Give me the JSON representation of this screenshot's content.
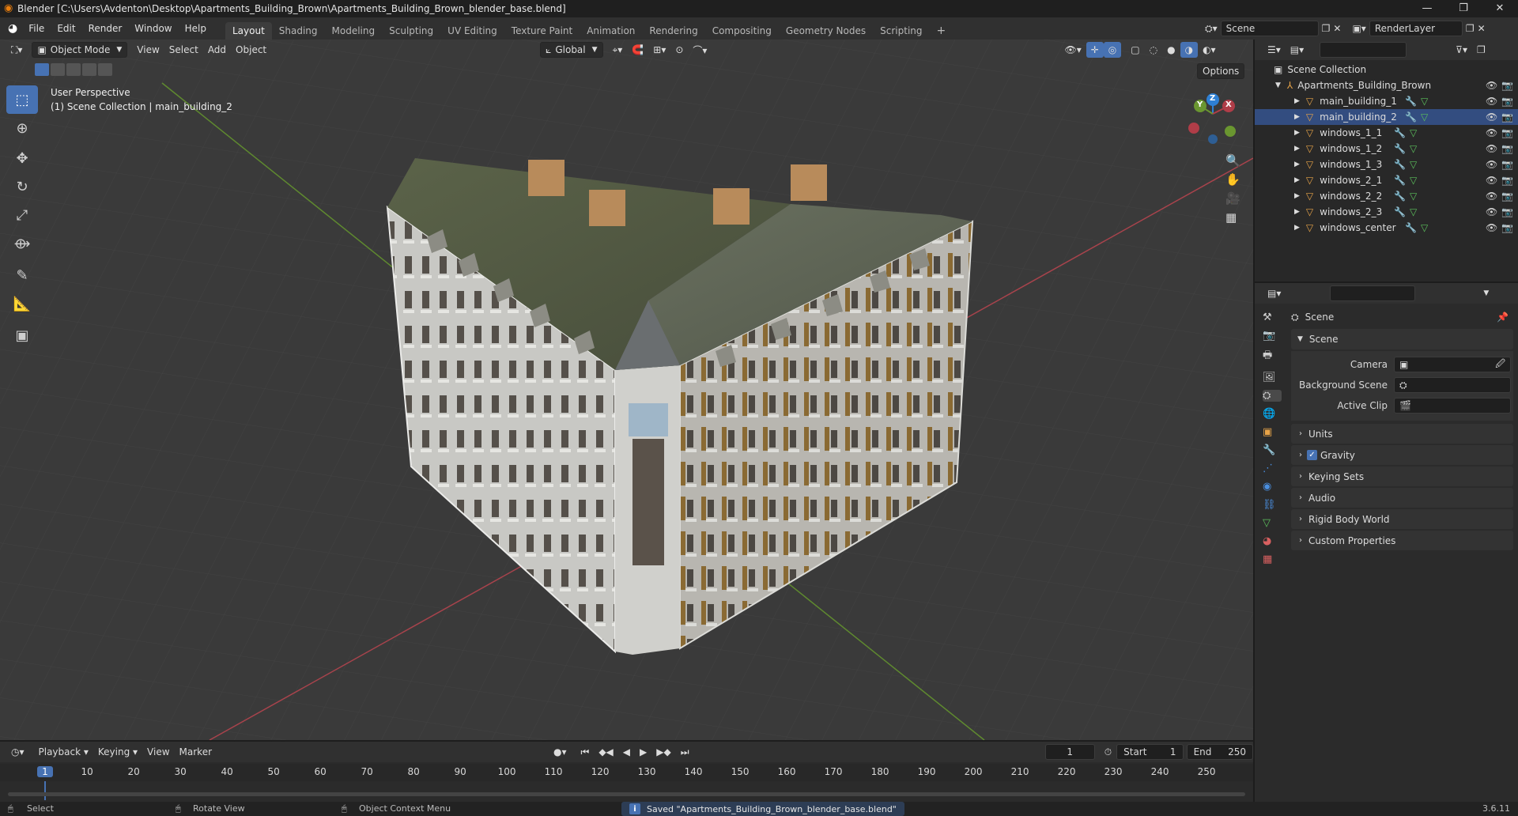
{
  "window": {
    "title": "Blender [C:\\Users\\Avdenton\\Desktop\\Apartments_Building_Brown\\Apartments_Building_Brown_blender_base.blend]",
    "controls": [
      "—",
      "❐",
      "✕"
    ]
  },
  "menubar": {
    "menus": [
      "File",
      "Edit",
      "Render",
      "Window",
      "Help"
    ],
    "workspaces": [
      "Layout",
      "Shading",
      "Modeling",
      "Sculpting",
      "UV Editing",
      "Texture Paint",
      "Animation",
      "Rendering",
      "Compositing",
      "Geometry Nodes",
      "Scripting"
    ],
    "active_workspace": "Layout",
    "add_workspace": "+",
    "scene_name": "Scene",
    "view_layer": "RenderLayer"
  },
  "viewport_header": {
    "mode": "Object Mode",
    "menus": [
      "View",
      "Select",
      "Add",
      "Object"
    ],
    "orientation": "Global",
    "options": "Options"
  },
  "viewport": {
    "perspective_label": "User Perspective",
    "collection_label": "(1) Scene Collection | main_building_2",
    "gizmo_axes": [
      "X",
      "Y",
      "Z"
    ],
    "colors": {
      "x_axis": "#b03d48",
      "y_axis": "#6a9630",
      "z_axis": "#2e80d4",
      "grid": "#454545",
      "background": "#3a3a3a"
    }
  },
  "outliner": {
    "root": "Scene Collection",
    "collection": "Apartments_Building_Brown",
    "objects": [
      "main_building_1",
      "main_building_2",
      "windows_1_1",
      "windows_1_2",
      "windows_1_3",
      "windows_2_1",
      "windows_2_2",
      "windows_2_3",
      "windows_center"
    ]
  },
  "properties": {
    "context_title": "Scene",
    "section": "Scene",
    "fields": [
      {
        "label": "Camera",
        "value": ""
      },
      {
        "label": "Background Scene",
        "value": ""
      },
      {
        "label": "Active Clip",
        "value": ""
      }
    ],
    "panels": [
      "Units",
      "Gravity",
      "Keying Sets",
      "Audio",
      "Rigid Body World",
      "Custom Properties"
    ],
    "gravity_checked": true
  },
  "timeline": {
    "menus": [
      "Playback",
      "Keying",
      "View",
      "Marker"
    ],
    "current_frame": "1",
    "start_label": "Start",
    "start": "1",
    "end_label": "End",
    "end": "250",
    "ruler": [
      "1",
      "10",
      "20",
      "30",
      "40",
      "50",
      "60",
      "70",
      "80",
      "90",
      "100",
      "110",
      "120",
      "130",
      "140",
      "150",
      "160",
      "170",
      "180",
      "190",
      "200",
      "210",
      "220",
      "230",
      "240",
      "250"
    ]
  },
  "statusbar": {
    "select": "Select",
    "rotate": "Rotate View",
    "context_menu": "Object Context Menu",
    "message": "Saved \"Apartments_Building_Brown_blender_base.blend\"",
    "version": "3.6.11"
  }
}
